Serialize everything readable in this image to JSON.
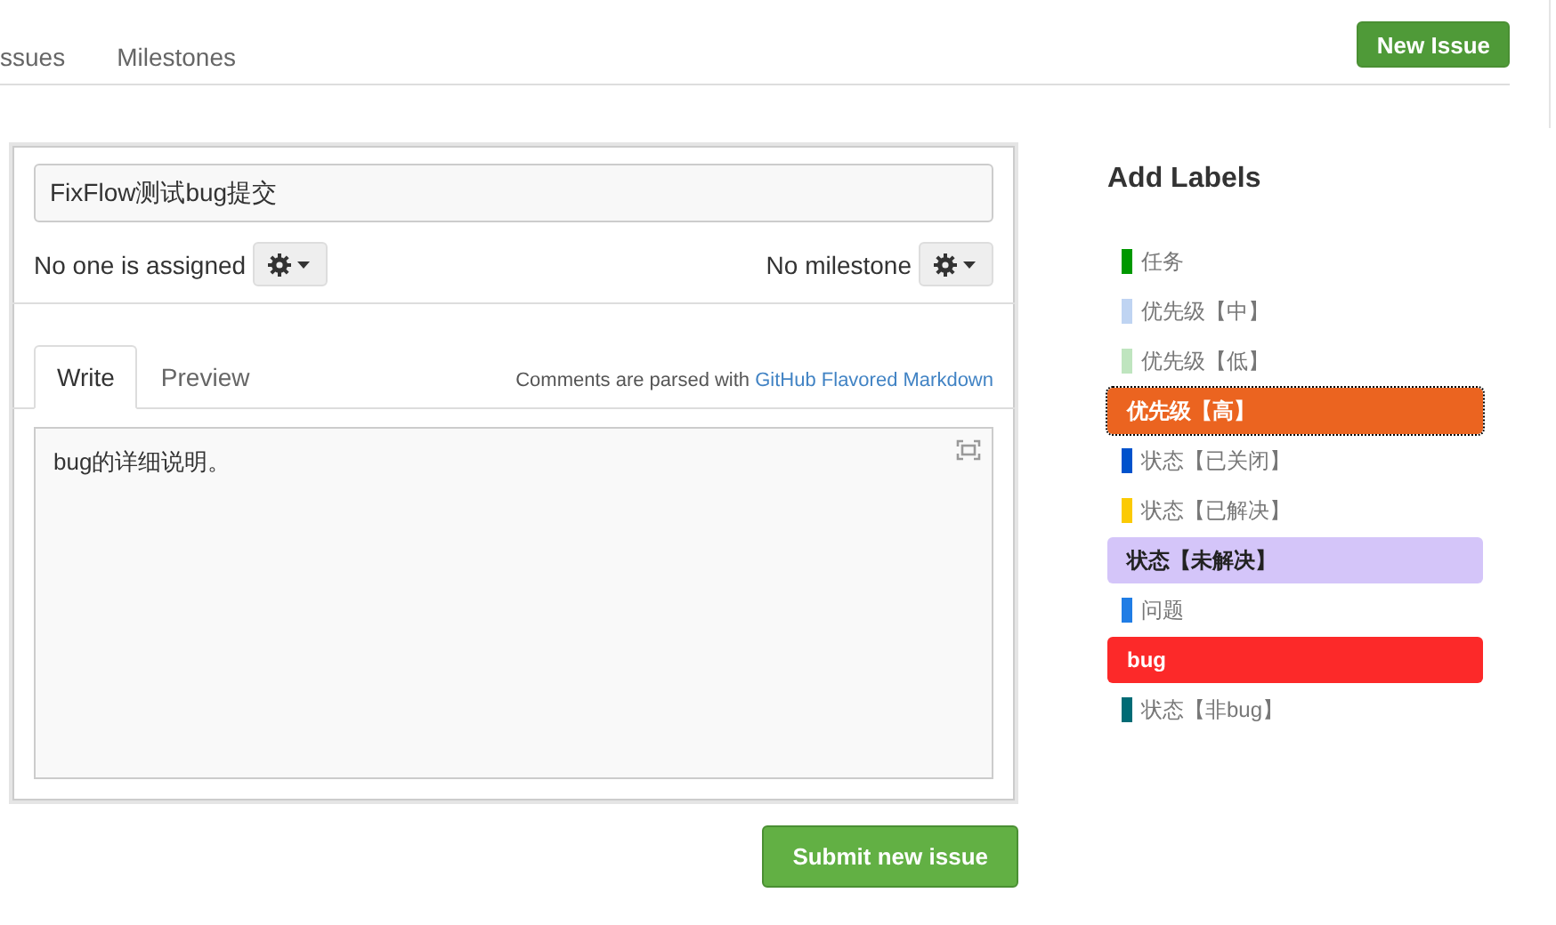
{
  "nav": {
    "tabs": [
      {
        "label": "ssues",
        "selected": false
      },
      {
        "label": "Milestones",
        "selected": false
      }
    ],
    "new_button": "New Issue"
  },
  "form": {
    "title_value": "FixFlow测试bug提交",
    "assignee": "No one is assigned",
    "milestone": "No milestone",
    "editor_tabs": [
      {
        "label": "Write",
        "selected": true
      },
      {
        "label": "Preview",
        "selected": false
      }
    ],
    "hint": "Comments are parsed with",
    "hint_link": "GitHub Flavored Markdown",
    "body_value": "bug的详细说明。",
    "submit": "Submit new issue"
  },
  "labels": {
    "title": "Add Labels",
    "items": [
      {
        "name": "任务",
        "color": "#009800",
        "selected": false,
        "focused": false
      },
      {
        "name": "优先级【中】",
        "color": "#bfd4f2",
        "selected": false,
        "focused": false
      },
      {
        "name": "优先级【低】",
        "color": "#bfe5bf",
        "selected": false,
        "focused": false
      },
      {
        "name": "优先级【高】",
        "color": "#eb6420",
        "selected": true,
        "focused": true
      },
      {
        "name": "状态【已关闭】",
        "color": "#0052cc",
        "selected": false,
        "focused": false
      },
      {
        "name": "状态【已解决】",
        "color": "#fbca04",
        "selected": false,
        "focused": false
      },
      {
        "name": "状态【未解决】",
        "color": "#d4c5f9",
        "selected": true,
        "focused": false
      },
      {
        "name": "问题",
        "color": "#207de5",
        "selected": false,
        "focused": false
      },
      {
        "name": "bug",
        "color": "#fc2929",
        "selected": true,
        "focused": false
      },
      {
        "name": "状态【非bug】",
        "color": "#006b75",
        "selected": false,
        "focused": false
      }
    ]
  }
}
